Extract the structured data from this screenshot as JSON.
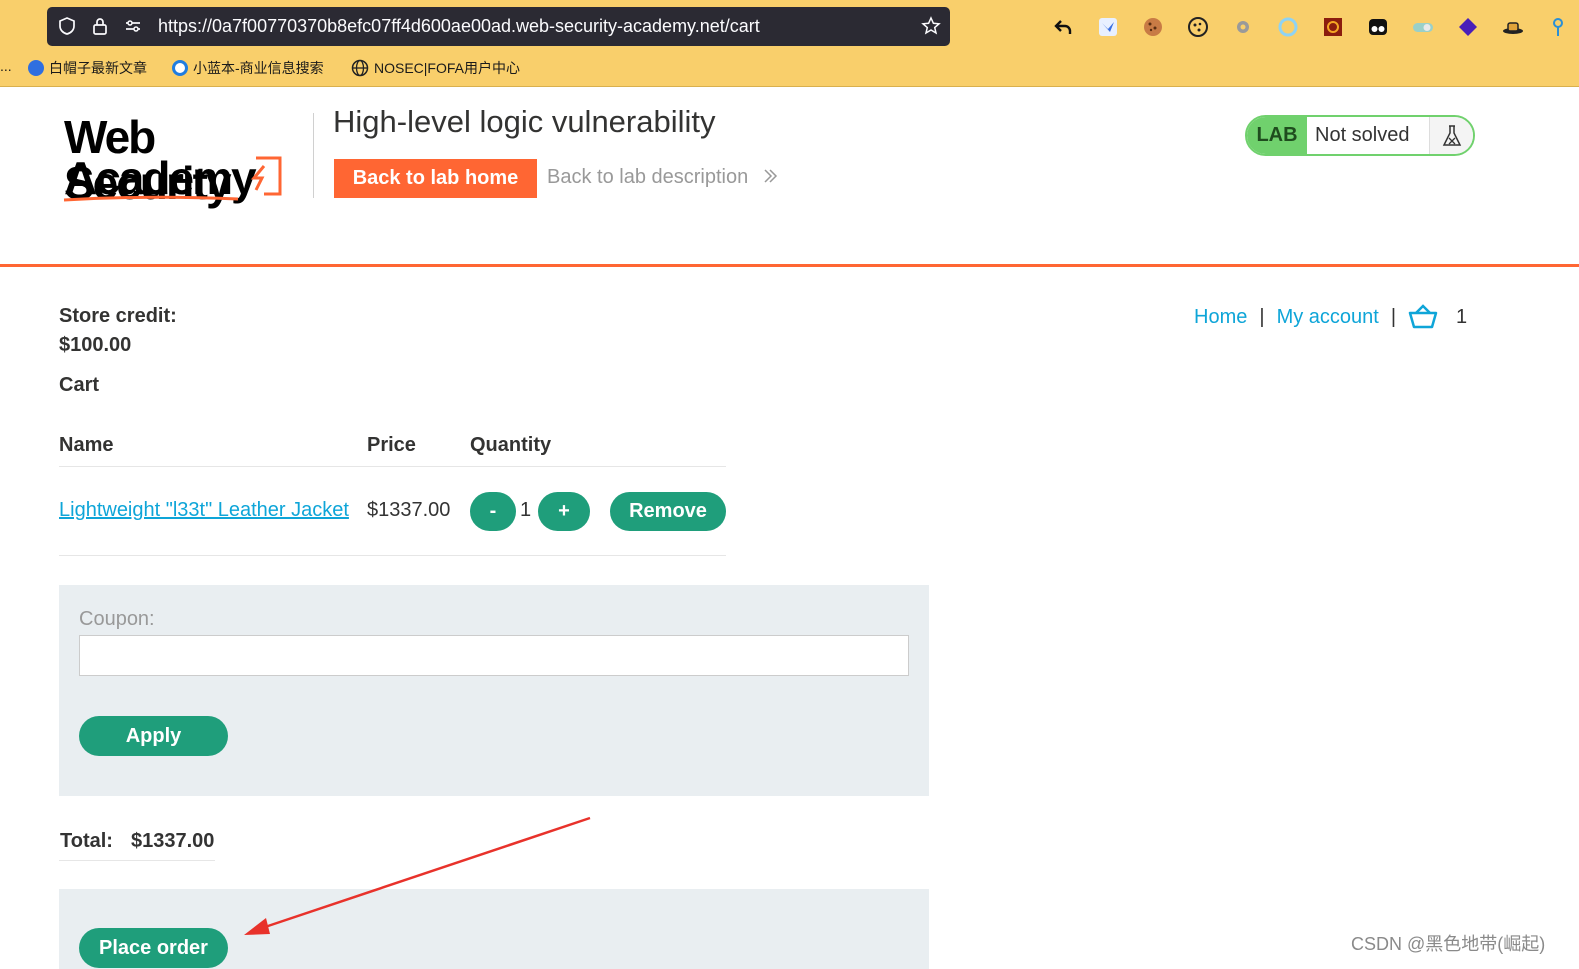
{
  "browser": {
    "url": "https://0a7f00770370b8efc07ff4d600ae00ad.web-security-academy.net/cart",
    "bookmarks": [
      "...",
      "白帽子最新文章",
      "小蓝本-商业信息搜索",
      "NOSEC|FOFA用户中心"
    ]
  },
  "header": {
    "logo_line1": "Web Security",
    "logo_line2": "Academy",
    "lab_title": "High-level logic vulnerability",
    "back_home": "Back to lab home",
    "back_desc": "Back to lab description",
    "status_tag": "LAB",
    "status": "Not solved"
  },
  "nav": {
    "home": "Home",
    "sep": "|",
    "account": "My account",
    "cart_count": "1"
  },
  "store": {
    "credit_label": "Store credit:",
    "credit_value": "$100.00",
    "cart_heading": "Cart"
  },
  "cart_table": {
    "headers": [
      "Name",
      "Price",
      "Quantity"
    ],
    "rows": [
      {
        "name": "Lightweight \"l33t\" Leather Jacket",
        "price": "$1337.00",
        "quantity": "1"
      }
    ],
    "minus": "-",
    "plus": "+",
    "remove": "Remove"
  },
  "coupon": {
    "label": "Coupon:",
    "value": "",
    "apply": "Apply"
  },
  "total": {
    "label": "Total:",
    "value": "$1337.00"
  },
  "checkout": {
    "place_order": "Place order"
  },
  "watermark": "CSDN @黑色地带(崛起)",
  "colors": {
    "accent_orange": "#ff6633",
    "button_green": "#1f9e7b",
    "link_blue": "#0ea5d8",
    "lab_green": "#70d16d",
    "panel_gray": "#e9eef1",
    "chrome_yellow": "#f9cf6b"
  },
  "icons": [
    "shield-icon",
    "lock-icon",
    "permissions-icon",
    "star-icon",
    "back-icon",
    "cookie-icon",
    "basket-icon",
    "flask-icon",
    "arrow-annotation"
  ]
}
